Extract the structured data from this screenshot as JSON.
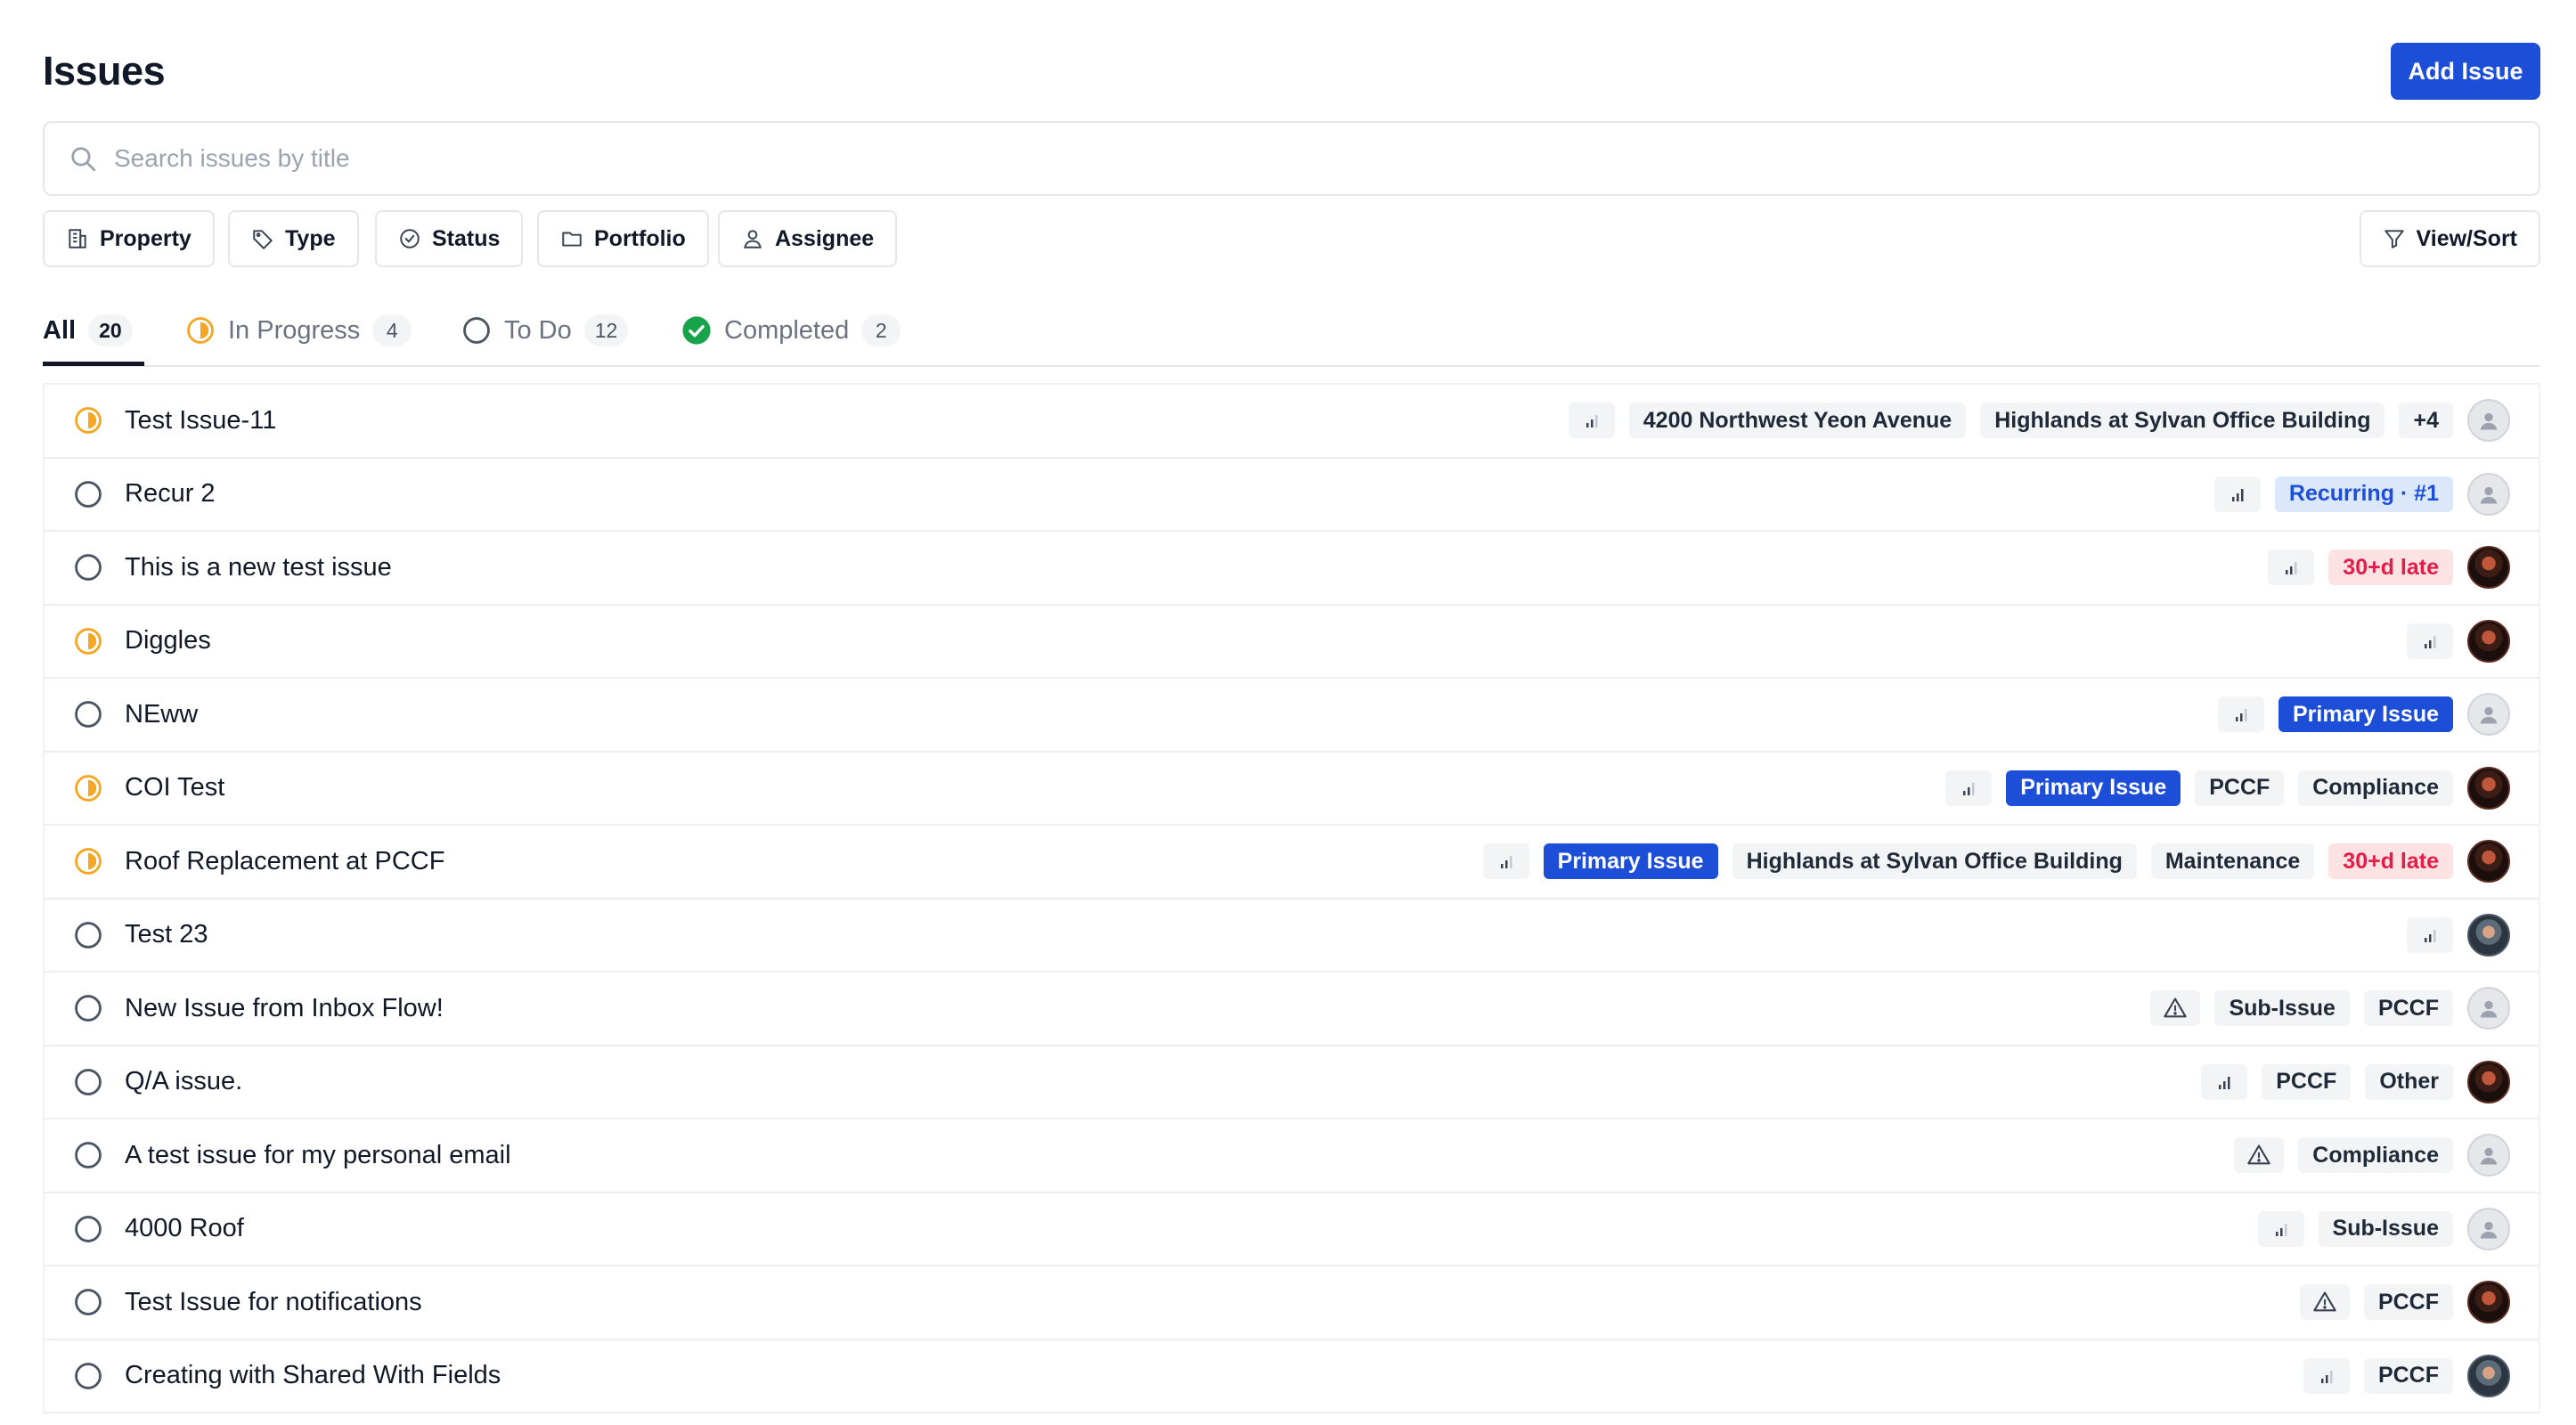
{
  "header": {
    "title": "Issues",
    "add_button": "Add Issue"
  },
  "search": {
    "placeholder": "Search issues by title"
  },
  "filters": {
    "property": "Property",
    "type": "Type",
    "status": "Status",
    "portfolio": "Portfolio",
    "assignee": "Assignee",
    "view_sort": "View/Sort"
  },
  "tabs": [
    {
      "label": "All",
      "count": "20"
    },
    {
      "label": "In Progress",
      "count": "4"
    },
    {
      "label": "To Do",
      "count": "12"
    },
    {
      "label": "Completed",
      "count": "2"
    }
  ],
  "colors": {
    "accent": "#1d4ed8",
    "in_progress": "#f5a623",
    "completed": "#16a34a",
    "late": "#e11d48"
  },
  "issues": [
    {
      "title": "Test Issue-11",
      "status": "in-progress",
      "tags": [
        "4200 Northwest Yeon Avenue",
        "Highlands at Sylvan Office Building",
        "+4"
      ]
    },
    {
      "title": "Recur 2",
      "status": "todo",
      "tags": [
        "Recurring · #1"
      ]
    },
    {
      "title": "This is a new test issue",
      "status": "todo",
      "tags": [
        "30+d late"
      ]
    },
    {
      "title": "Diggles",
      "status": "in-progress",
      "tags": []
    },
    {
      "title": "NEww",
      "status": "todo",
      "tags": [
        "Primary Issue"
      ]
    },
    {
      "title": "COI Test",
      "status": "in-progress",
      "tags": [
        "Primary Issue",
        "PCCF",
        "Compliance"
      ]
    },
    {
      "title": "Roof Replacement at PCCF",
      "status": "in-progress",
      "tags": [
        "Primary Issue",
        "Highlands at Sylvan Office Building",
        "Maintenance",
        "30+d late"
      ]
    },
    {
      "title": "Test 23",
      "status": "todo",
      "tags": []
    },
    {
      "title": "New Issue from Inbox Flow!",
      "status": "todo",
      "tags": [
        "Sub-Issue",
        "PCCF"
      ]
    },
    {
      "title": "Q/A issue.",
      "status": "todo",
      "tags": [
        "PCCF",
        "Other"
      ]
    },
    {
      "title": "A test issue for my personal email",
      "status": "todo",
      "tags": [
        "Compliance"
      ]
    },
    {
      "title": "4000 Roof",
      "status": "todo",
      "tags": [
        "Sub-Issue"
      ]
    },
    {
      "title": "Test Issue for notifications",
      "status": "todo",
      "tags": [
        "PCCF"
      ]
    },
    {
      "title": "Creating with Shared With Fields",
      "status": "todo",
      "tags": [
        "PCCF"
      ]
    }
  ]
}
